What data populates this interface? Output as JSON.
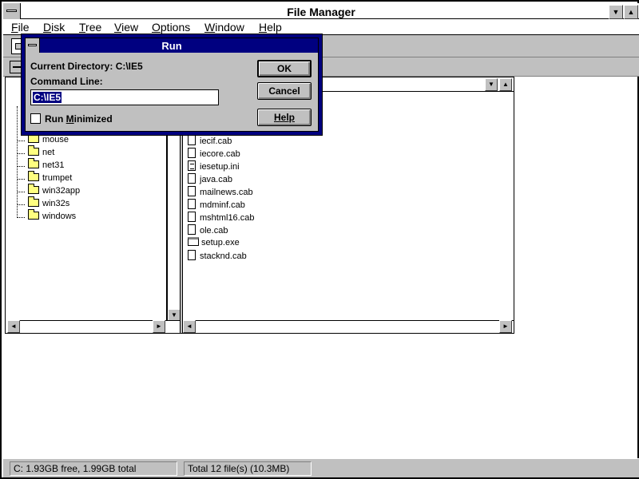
{
  "app": {
    "title": "File Manager",
    "menu": [
      {
        "pre": "",
        "ul": "F",
        "post": "ile"
      },
      {
        "pre": "",
        "ul": "D",
        "post": "isk"
      },
      {
        "pre": "",
        "ul": "T",
        "post": "ree"
      },
      {
        "pre": "",
        "ul": "V",
        "post": "iew"
      },
      {
        "pre": "",
        "ul": "O",
        "post": "ptions"
      },
      {
        "pre": "",
        "ul": "W",
        "post": "indow"
      },
      {
        "pre": "",
        "ul": "H",
        "post": "elp"
      }
    ]
  },
  "tree": {
    "folders": [
      "mouse",
      "net",
      "net31",
      "trumpet",
      "win32app",
      "win32s",
      "windows"
    ]
  },
  "files": {
    "items": [
      {
        "name": "iecif.cab",
        "icon": "file-icon"
      },
      {
        "name": "iecore.cab",
        "icon": "file-icon"
      },
      {
        "name": "iesetup.ini",
        "icon": "document-icon"
      },
      {
        "name": "java.cab",
        "icon": "file-icon"
      },
      {
        "name": "mailnews.cab",
        "icon": "file-icon"
      },
      {
        "name": "mdminf.cab",
        "icon": "file-icon"
      },
      {
        "name": "mshtml16.cab",
        "icon": "file-icon"
      },
      {
        "name": "ole.cab",
        "icon": "file-icon"
      },
      {
        "name": "setup.exe",
        "icon": "program-icon"
      },
      {
        "name": "stacknd.cab",
        "icon": "file-icon"
      }
    ]
  },
  "status": {
    "disk_free": "C: 1.93GB free,  1.99GB total",
    "total_files": "Total 12 file(s) (10.3MB)"
  },
  "run_dialog": {
    "title": "Run",
    "current_directory": "Current Directory: C:\\IE5",
    "command_line_label": "Command Line:",
    "command_value": "C:\\IE5",
    "run_minimized_pre": "Run ",
    "run_minimized_ul": "M",
    "run_minimized_post": "inimized",
    "ok_label": "OK",
    "cancel_label": "Cancel",
    "help_label": "Help"
  }
}
